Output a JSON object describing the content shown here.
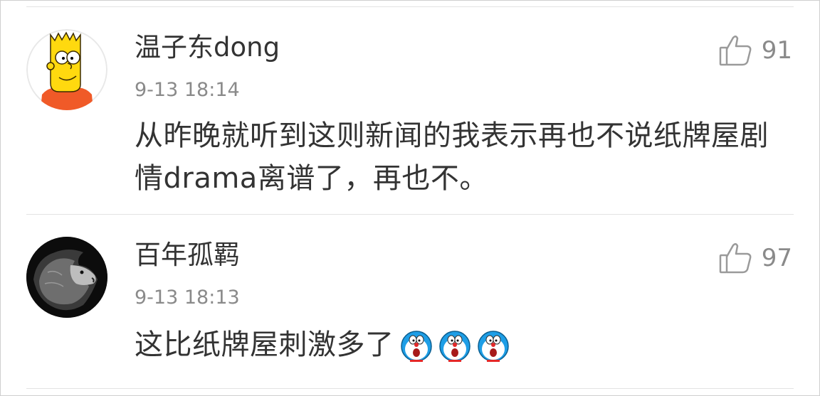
{
  "comments": [
    {
      "username": "温子东dong",
      "time": "9-13 18:14",
      "text": "从昨晚就听到这则新闻的我表示再也不说纸牌屋剧情drama离谱了，再也不。",
      "likes": "91",
      "avatar_icon": "bart-simpson-avatar-icon"
    },
    {
      "username": "百年孤羁",
      "time": "9-13 18:13",
      "text": "这比纸牌屋刺激多了",
      "likes": "97",
      "avatar_icon": "lion-avatar-icon",
      "emojis": [
        "doraemon-surprised-icon",
        "doraemon-surprised-icon",
        "doraemon-surprised-icon"
      ]
    }
  ],
  "colors": {
    "text_primary": "#333333",
    "text_secondary": "#8a8a8a",
    "divider": "#e3e3e3",
    "background": "#ffffff"
  }
}
